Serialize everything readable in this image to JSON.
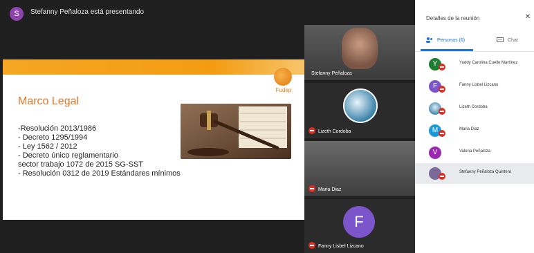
{
  "header": {
    "presenter_initial": "S",
    "title": "Stefanny Peñaloza está presentando"
  },
  "slide": {
    "title": "Marco Legal",
    "logo_text": "Fudep",
    "lines": [
      "-Resolución 2013/1986",
      "-  Decreto 1295/1994",
      "-  Ley 1562 / 2012",
      "-  Decreto único reglamentario",
      "sector trabajo 1072 de 2015 SG-SST",
      "-   Resolución 0312 de 2019 Estándares mínimos"
    ]
  },
  "tiles": [
    {
      "name": "Stefanny Peñaloza"
    },
    {
      "name": "Lizeth Cordoba"
    },
    {
      "name": "Maria Diaz"
    },
    {
      "name": "Fanny Lisbel Lizcano",
      "initial": "F"
    }
  ],
  "panel": {
    "title": "Detalles de la reunión",
    "tab_people": "Personas (6)",
    "tab_chat": "Chat"
  },
  "people": [
    {
      "initial": "Y",
      "name": "Yuddy Carolina Cuello Martínez",
      "color": "#1e7e34"
    },
    {
      "initial": "F",
      "name": "Fanny Lisbel Lizcano",
      "color": "#7b55c9"
    },
    {
      "initial": "",
      "name": "Lizeth Cordoba",
      "color": "#4a8db0"
    },
    {
      "initial": "M",
      "name": "Maria Diaz",
      "color": "#1a9bd7"
    },
    {
      "initial": "V",
      "name": "Valeria Peñaloza",
      "color": "#9c27b0"
    },
    {
      "initial": "",
      "name": "Stefanny Peñaloza Quintero",
      "color": "#7a6a9a"
    }
  ],
  "colors": {
    "accent_blue": "#1a73e8",
    "mute_red": "#d93025",
    "slide_orange": "#f39c12"
  }
}
